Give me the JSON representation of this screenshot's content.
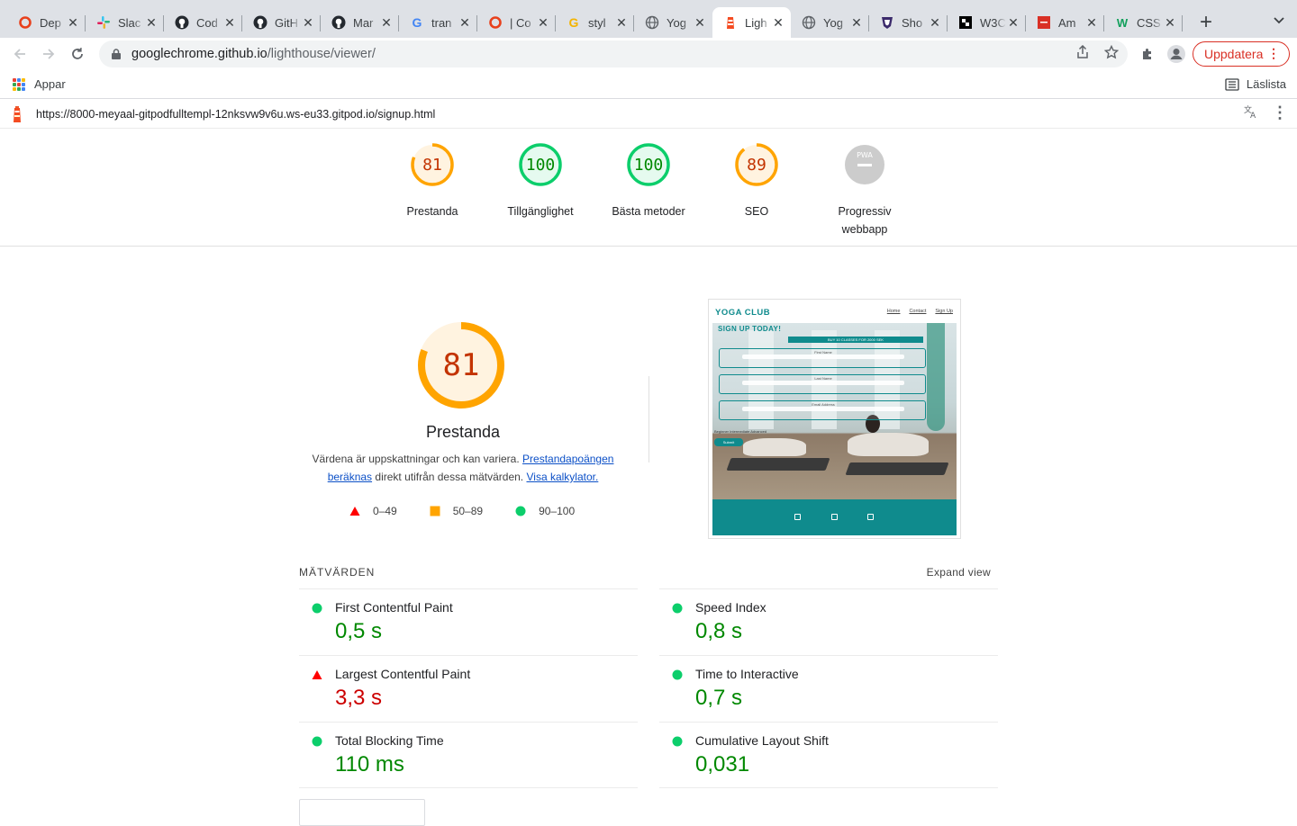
{
  "browser": {
    "tabs": [
      {
        "title": "Dep",
        "icon": "opera-ring-icon",
        "color": "#e8401c"
      },
      {
        "title": "Slac",
        "icon": "slack-icon",
        "color": "#e01e5a"
      },
      {
        "title": "Cod",
        "icon": "github-icon",
        "color": "#24292f"
      },
      {
        "title": "GitH",
        "icon": "github-icon",
        "color": "#24292f"
      },
      {
        "title": "Mar",
        "icon": "github-icon",
        "color": "#24292f"
      },
      {
        "title": "tran",
        "icon": "google-icon",
        "color": "#4285f4"
      },
      {
        "title": "| Co",
        "icon": "opera-ring-icon",
        "color": "#e8401c"
      },
      {
        "title": "styl",
        "icon": "google-g-icon",
        "color": "#f4b400"
      },
      {
        "title": "Yog",
        "icon": "globe-icon",
        "color": "#5f6368"
      },
      {
        "title": "Ligh",
        "icon": "lighthouse-icon",
        "color": "#f44b21",
        "active": true
      },
      {
        "title": "Yog",
        "icon": "globe-icon",
        "color": "#5f6368"
      },
      {
        "title": "Sho",
        "icon": "shield-logo-icon",
        "color": "#3b2a6b"
      },
      {
        "title": "W3C",
        "icon": "w3c-icon",
        "color": "#000000"
      },
      {
        "title": "Am",
        "icon": "am-icon",
        "color": "#d93025"
      },
      {
        "title": "CSS",
        "icon": "w-icon",
        "color": "#12a05c"
      }
    ],
    "new_tab_label": "+",
    "url_host": "googlechrome.github.io",
    "url_path": "/lighthouse/viewer/",
    "update_label": "Uppdatera",
    "bookmarks_apps_label": "Appar",
    "reading_list_label": "Läslista"
  },
  "lighthouse": {
    "report_url": "https://8000-meyaal-gitpodfulltempl-12nksvw9v6u.ws-eu33.gitpod.io/signup.html",
    "summary": [
      {
        "score": "81",
        "label": "Prestanda",
        "status": "average",
        "fraction": 0.81
      },
      {
        "score": "100",
        "label": "Tillgänglighet",
        "status": "pass",
        "fraction": 1.0
      },
      {
        "score": "100",
        "label": "Bästa metoder",
        "status": "pass",
        "fraction": 1.0
      },
      {
        "score": "89",
        "label": "SEO",
        "status": "average",
        "fraction": 0.89
      },
      {
        "score": "PWA",
        "label": "Progressiv webbapp",
        "status": "na",
        "fraction": 0
      }
    ],
    "perf": {
      "score": "81",
      "fraction": 0.81,
      "title": "Prestanda",
      "desc_text": "Värdena är uppskattningar och kan variera. ",
      "desc_link1": "Prestandapoängen beräknas",
      "desc_mid": " direkt utifrån dessa mätvärden. ",
      "desc_link2": "Visa kalkylator.",
      "legend": [
        {
          "range": "0–49",
          "shape": "triangle",
          "color": "#ff0000"
        },
        {
          "range": "50–89",
          "shape": "square",
          "color": "#ffa400"
        },
        {
          "range": "90–100",
          "shape": "circle",
          "color": "#0cce6b"
        }
      ]
    },
    "screenshot": {
      "brand": "YOGA CLUB",
      "nav": [
        "Home",
        "Contact",
        "Sign Up"
      ],
      "hero_title": "SIGN UP TODAY!",
      "strip": "BUY 10 CLASSES FOR 2000 SEK",
      "fields": [
        "First Name",
        "Last Name",
        "Email Address"
      ],
      "levels": "Beginner  Intermediate  Advanced",
      "submit": "Submit"
    },
    "metrics_title": "MÄTVÄRDEN",
    "expand_label": "Expand view",
    "metrics": [
      {
        "name": "First Contentful Paint",
        "value": "0,5 s",
        "status": "pass"
      },
      {
        "name": "Speed Index",
        "value": "0,8 s",
        "status": "pass"
      },
      {
        "name": "Largest Contentful Paint",
        "value": "3,3 s",
        "status": "fail"
      },
      {
        "name": "Time to Interactive",
        "value": "0,7 s",
        "status": "pass"
      },
      {
        "name": "Total Blocking Time",
        "value": "110 ms",
        "status": "pass"
      },
      {
        "name": "Cumulative Layout Shift",
        "value": "0,031",
        "status": "pass"
      }
    ],
    "colors": {
      "pass": "#0cce6b",
      "pass_text": "#008800",
      "average": "#ffa400",
      "average_text": "#c33300",
      "fail": "#ff0000",
      "fail_text": "#cc0000",
      "na": "#cccccc"
    }
  }
}
